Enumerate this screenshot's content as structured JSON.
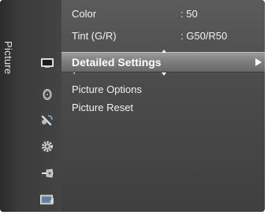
{
  "tab": {
    "label": "Picture"
  },
  "menu": {
    "rows": [
      {
        "label": "Color",
        "value": ": 50"
      },
      {
        "label": "Tint (G/R)",
        "value": ": G50/R50"
      },
      {
        "label": "Detailed Settings",
        "value": ""
      },
      {
        "label": "Picture Options",
        "value": ""
      },
      {
        "label": "Picture Reset",
        "value": ""
      }
    ]
  },
  "icons": [
    "picture-icon",
    "sound-icon",
    "channel-icon",
    "setup-icon",
    "input-icon",
    "application-icon"
  ]
}
